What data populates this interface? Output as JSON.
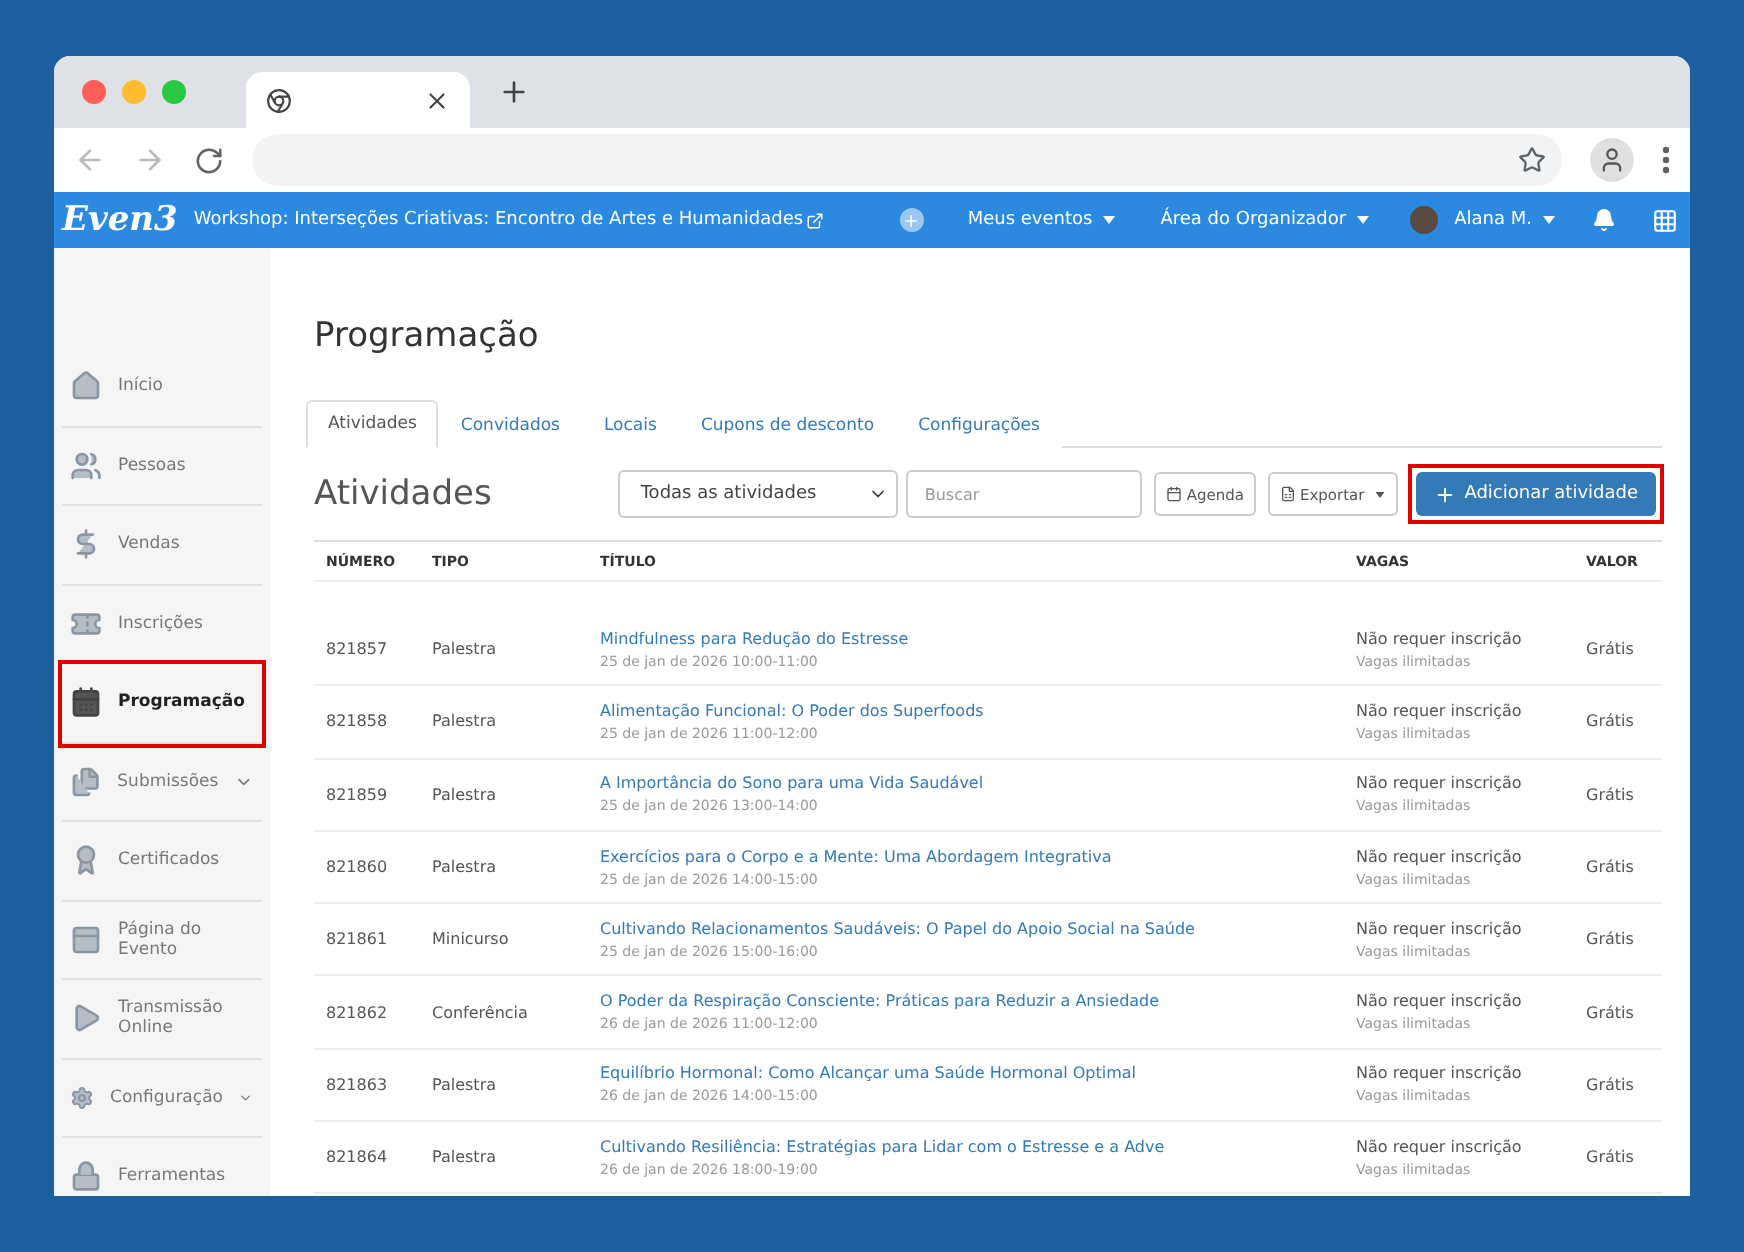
{
  "app_header": {
    "logo": "Even3",
    "event_title": "Workshop: Interseções Criativas: Encontro de Artes e Humanidades",
    "menus": [
      "Meus eventos",
      "Área do Organizador"
    ],
    "user": "Alana M."
  },
  "sidebar": {
    "items": [
      {
        "label": "Início",
        "selected": false,
        "expandable": false,
        "highlighted": false
      },
      {
        "label": "Pessoas",
        "selected": false,
        "expandable": false,
        "highlighted": false
      },
      {
        "label": "Vendas",
        "selected": false,
        "expandable": false,
        "highlighted": false
      },
      {
        "label": "Inscrições",
        "selected": false,
        "expandable": false,
        "highlighted": false
      },
      {
        "label": "Programação",
        "selected": true,
        "expandable": false,
        "highlighted": true
      },
      {
        "label": "Submissões",
        "selected": false,
        "expandable": true,
        "highlighted": false
      },
      {
        "label": "Certificados",
        "selected": false,
        "expandable": false,
        "highlighted": false
      },
      {
        "label": "Página do Evento",
        "selected": false,
        "expandable": false,
        "highlighted": false
      },
      {
        "label": "Transmissão Online",
        "selected": false,
        "expandable": false,
        "highlighted": false
      },
      {
        "label": "Configuração",
        "selected": false,
        "expandable": true,
        "highlighted": false
      },
      {
        "label": "Ferramentas",
        "selected": false,
        "expandable": false,
        "highlighted": false
      }
    ]
  },
  "page_title": "Programação",
  "tabs": [
    {
      "label": "Atividades",
      "selected": true
    },
    {
      "label": "Convidados",
      "selected": false
    },
    {
      "label": "Locais",
      "selected": false
    },
    {
      "label": "Cupons de desconto",
      "selected": false
    },
    {
      "label": "Configurações",
      "selected": false
    }
  ],
  "section_title": "Atividades",
  "filter": {
    "value": "Todas as atividades"
  },
  "search": {
    "placeholder": "Buscar"
  },
  "buttons": {
    "agenda": "Agenda",
    "export": "Exportar",
    "add": "Adicionar atividade",
    "add_highlighted": true
  },
  "table": {
    "columns": [
      "NÚMERO",
      "TIPO",
      "TÍTULO",
      "VAGAS",
      "VALOR"
    ],
    "rows": [
      {
        "number": "821857",
        "type": "Palestra",
        "title": "Mindfulness para Redução do Estresse",
        "date": "25 de jan de 2026 10:00-11:00",
        "vagas": "Não requer inscrição",
        "vagas_note": "Vagas ilimitadas",
        "valor": "Grátis"
      },
      {
        "number": "821858",
        "type": "Palestra",
        "title": "Alimentação Funcional: O Poder dos Superfoods",
        "date": "25 de jan de 2026 11:00-12:00",
        "vagas": "Não requer inscrição",
        "vagas_note": "Vagas ilimitadas",
        "valor": "Grátis"
      },
      {
        "number": "821859",
        "type": "Palestra",
        "title": "A Importância do Sono para uma Vida Saudável",
        "date": "25 de jan de 2026 13:00-14:00",
        "vagas": "Não requer inscrição",
        "vagas_note": "Vagas ilimitadas",
        "valor": "Grátis"
      },
      {
        "number": "821860",
        "type": "Palestra",
        "title": "Exercícios para o Corpo e a Mente: Uma Abordagem Integrativa",
        "date": "25 de jan de 2026 14:00-15:00",
        "vagas": "Não requer inscrição",
        "vagas_note": "Vagas ilimitadas",
        "valor": "Grátis"
      },
      {
        "number": "821861",
        "type": "Minicurso",
        "title": "Cultivando Relacionamentos Saudáveis: O Papel do Apoio Social na Saúde",
        "date": "25 de jan de 2026 15:00-16:00",
        "vagas": "Não requer inscrição",
        "vagas_note": "Vagas ilimitadas",
        "valor": "Grátis"
      },
      {
        "number": "821862",
        "type": "Conferência",
        "title": "O Poder da Respiração Consciente: Práticas para Reduzir a Ansiedade",
        "date": "26 de jan de 2026 11:00-12:00",
        "vagas": "Não requer inscrição",
        "vagas_note": "Vagas ilimitadas",
        "valor": "Grátis"
      },
      {
        "number": "821863",
        "type": "Palestra",
        "title": "Equilíbrio Hormonal: Como Alcançar uma Saúde Hormonal Optimal",
        "date": "26 de jan de 2026 14:00-15:00",
        "vagas": "Não requer inscrição",
        "vagas_note": "Vagas ilimitadas",
        "valor": "Grátis"
      },
      {
        "number": "821864",
        "type": "Palestra",
        "title": "Cultivando Resiliência: Estratégias para Lidar com o Estresse e a Adve",
        "date": "26 de jan de 2026 18:00-19:00",
        "vagas": "Não requer inscrição",
        "vagas_note": "Vagas ilimitadas",
        "valor": "Grátis"
      }
    ]
  }
}
